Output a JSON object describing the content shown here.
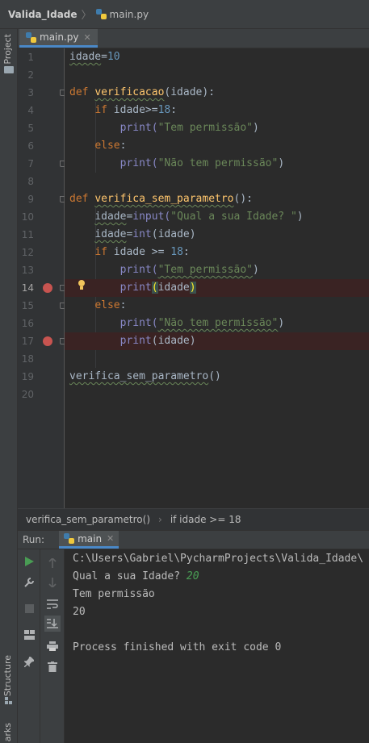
{
  "navbar": {
    "project": "Valida_Idade",
    "file": "main.py"
  },
  "left_strip": {
    "project_tab": "Project",
    "structure_tab": "Structure",
    "bookmarks_tab": "arks"
  },
  "editor_tabs": [
    {
      "label": "main.py"
    }
  ],
  "editor": {
    "line_numbers": [
      "1",
      "2",
      "3",
      "4",
      "5",
      "6",
      "7",
      "8",
      "9",
      "10",
      "11",
      "12",
      "13",
      "14",
      "15",
      "16",
      "17",
      "18",
      "19",
      "20"
    ],
    "lines": {
      "l1": {
        "var": "idade",
        "op": "=",
        "num": "10"
      },
      "l3": {
        "kw": "def",
        "fn": "verificacao",
        "rest": "(idade):"
      },
      "l4": {
        "kw": "if",
        "expr": " idade>=",
        "num": "18",
        "colon": ":"
      },
      "l5": {
        "call": "print(",
        "str": "\"Tem permissão\"",
        "close": ")"
      },
      "l6": {
        "kw": "else",
        "colon": ":"
      },
      "l7": {
        "call": "print(",
        "str": "\"Não tem permissão\"",
        "close": ")"
      },
      "l9": {
        "kw": "def",
        "fn": "verifica_sem_parametro",
        "rest": "():"
      },
      "l10": {
        "var": "idade",
        "op": "=",
        "call": "input(",
        "str": "\"Qual a sua Idade? \"",
        "close": ")"
      },
      "l11": {
        "var": "idade",
        "op": "=",
        "call": "int",
        "rest": "(idade)"
      },
      "l12": {
        "kw": "if",
        "expr": " idade >= ",
        "num": "18",
        "colon": ":"
      },
      "l13": {
        "call": "print(",
        "str": "\"Tem permissão\"",
        "close": ")"
      },
      "l14": {
        "call": "print",
        "open": "(",
        "arg": "idade",
        "close": ")"
      },
      "l15": {
        "kw": "else",
        "colon": ":"
      },
      "l16": {
        "call": "print(",
        "str": "\"Não tem permissão\"",
        "close": ")"
      },
      "l17": {
        "call": "print",
        "rest": "(idade)"
      },
      "l19": {
        "call": "verifica_sem_parametro",
        "rest": "()"
      }
    },
    "breakpoint_lines": [
      14,
      17
    ],
    "current_line": 14
  },
  "breadcrumb": {
    "func": "verifica_sem_parametro()",
    "stmt": "if idade >= 18"
  },
  "run_panel": {
    "label": "Run:",
    "tab": "main",
    "console": {
      "path": "C:\\Users\\Gabriel\\PycharmProjects\\Valida_Idade\\",
      "prompt": "Qual a sua Idade? ",
      "input": "20",
      "out1": "Tem permissão",
      "out2": "20",
      "finish": "Process finished with exit code 0"
    }
  },
  "colors": {
    "keyword": "#cc7832",
    "function": "#ffc66d",
    "number": "#6897bb",
    "string": "#6a8759",
    "breakpoint": "#c75450",
    "tab_accent": "#4a88c7"
  }
}
